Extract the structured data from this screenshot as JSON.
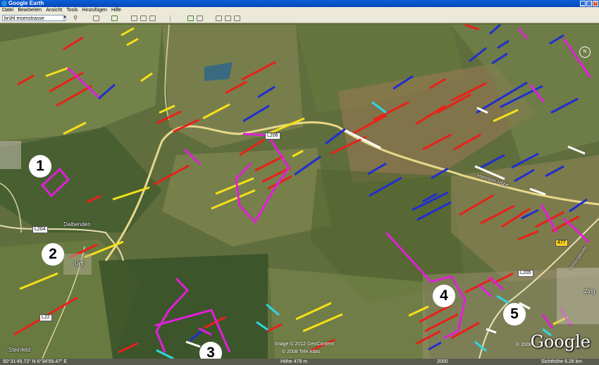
{
  "app": {
    "title": "Google Earth"
  },
  "menu": [
    "Datei",
    "Bearbeiten",
    "Ansicht",
    "Tools",
    "Hinzufügen",
    "Hilfe"
  ],
  "search": {
    "value": "brühl eisenstrasse"
  },
  "map": {
    "markers": [
      "1",
      "2",
      "3",
      "4",
      "5"
    ],
    "places": {
      "dalbenden": "Dalbenden",
      "urft": "Urft",
      "steinfeld": "Steinfeld",
      "zing": "Zing",
      "hansteinhoehe": "Hanstein-Höhe",
      "nurburgstrasse": "Nürburgstraße"
    },
    "roads": {
      "l204": "L204",
      "l206": "L206",
      "l205": "L205",
      "r477": "477",
      "l22": "L22"
    },
    "copyright1": "Image © 2012 GeoContent",
    "copyright2": "© 2008 Tele Atlas",
    "copyright3": "© 2008",
    "logo": "Google",
    "compass": "N"
  },
  "status": {
    "coords": "50°31'45.72\" N    6°34'59.47\" E",
    "altitude": "Höhe  479 m",
    "scale": "2000",
    "eye": "Sichthöhe    6.28 km"
  }
}
